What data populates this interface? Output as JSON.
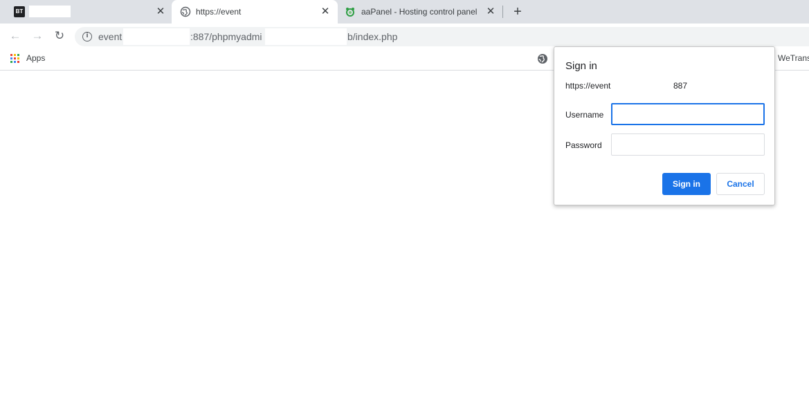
{
  "tabs": [
    {
      "icon": "bt-logo-icon",
      "logo_text": "BT",
      "title": "",
      "close": "✕"
    },
    {
      "icon": "globe-icon",
      "title": "https://event",
      "close": "✕"
    },
    {
      "icon": "aapanel-logo-icon",
      "title": "aaPanel - Hosting control panel. C",
      "close": "✕"
    }
  ],
  "new_tab_label": "+",
  "toolbar": {
    "back_icon": "←",
    "forward_icon": "→",
    "reload_icon": "↻",
    "info_icon": "i",
    "url_part1": "event",
    "url_part2": ":887/phpmyadmi",
    "url_part3": "b/index.php"
  },
  "bookmarks": {
    "apps_label": "Apps",
    "wetransfer_label": "WeTrans"
  },
  "dialog": {
    "title": "Sign in",
    "origin": "https://event",
    "port": "887",
    "username_label": "Username",
    "username_value": "",
    "password_label": "Password",
    "password_value": "",
    "signin_button": "Sign in",
    "cancel_button": "Cancel"
  },
  "colors": {
    "accent": "#1a73e8",
    "tabstrip": "#dee1e6",
    "omnibox": "#f1f3f4"
  }
}
